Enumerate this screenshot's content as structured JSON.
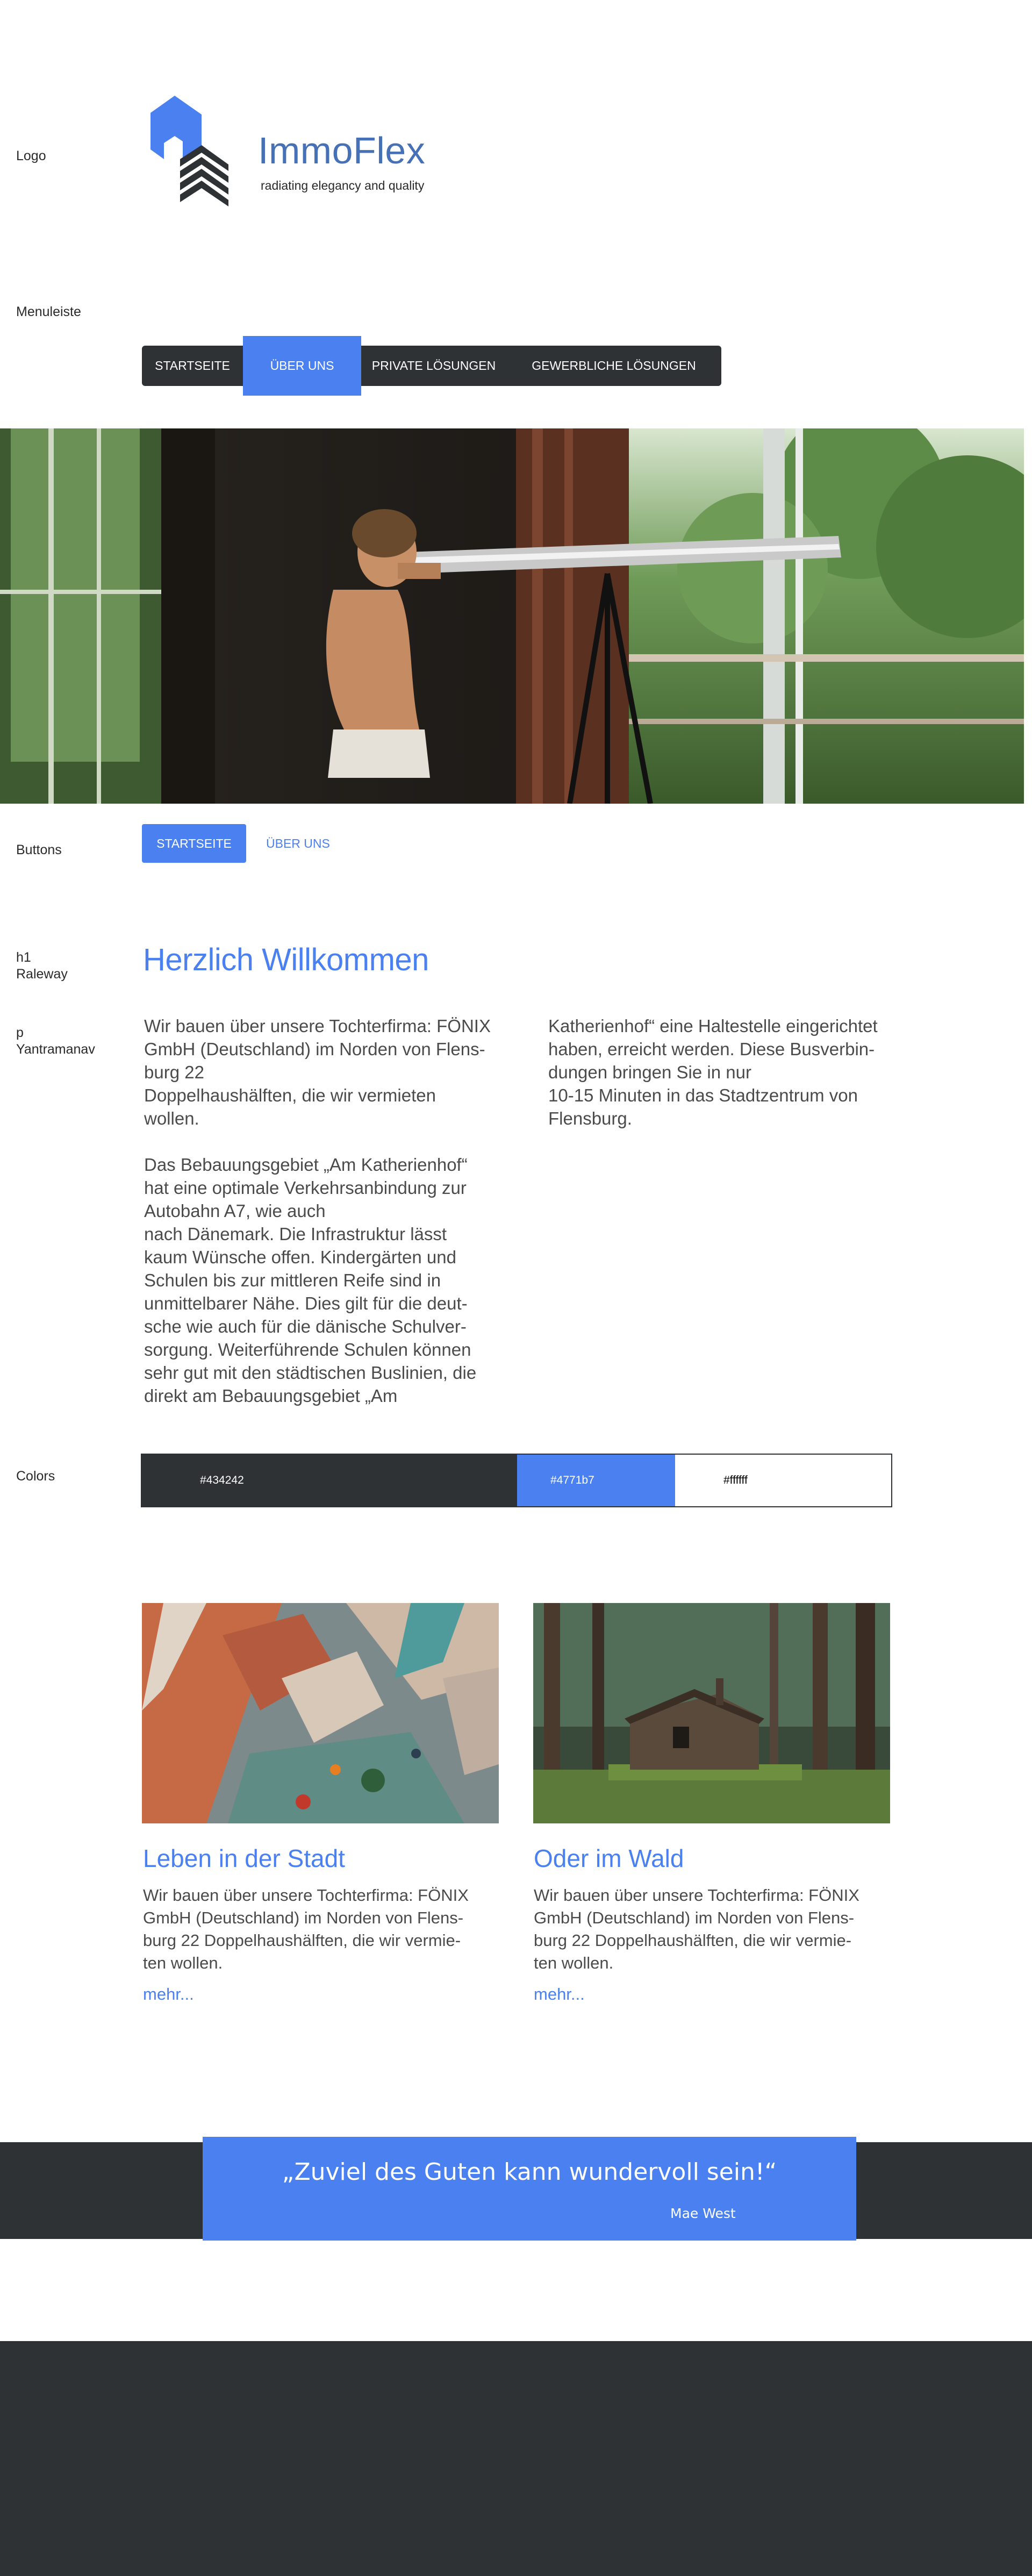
{
  "labels": {
    "logo": "Logo",
    "menu": "Menuleiste",
    "buttons": "Buttons",
    "h1_line1": "h1",
    "h1_line2": "Raleway",
    "p_line1": "p",
    "p_line2": "Yantramanav",
    "colors": "Colors"
  },
  "logo": {
    "name": "ImmoFlex",
    "tagline": "radiating elegancy and quality"
  },
  "menu": {
    "items": [
      {
        "label": "Startseite"
      },
      {
        "label": "Über uns"
      },
      {
        "label": "Private Lösungen"
      },
      {
        "label": "Gewerbliche Lösungen"
      }
    ],
    "active_index": 1
  },
  "buttons": {
    "primary": "Startseite",
    "secondary": "Über uns"
  },
  "headline": "Herzlich Willkommen",
  "paragraph": {
    "col1": "Wir bauen über unsere Tochterfirma: FÖNIX\nGmbH (Deutschland) im Norden von Flens-\nburg 22\nDoppelhaushälften, die wir vermieten\nwollen.\n\nDas Bebauungsgebiet „Am Katherienhof“\nhat eine optimale Verkehrsanbindung zur\nAutobahn A7, wie auch\nnach Dänemark. Die Infrastruktur lässt\nkaum Wünsche offen. Kindergärten und\nSchulen bis zur mittleren Reife sind in\nunmittelbarer Nähe. Dies gilt für die deut-\nsche wie auch für die dänische Schulver-\nsorgung. Weiterführende Schulen können\nsehr gut mit den städtischen Buslinien, die\ndirekt am Bebauungsgebiet „Am",
    "col2": "Katherienhof“ eine Haltestelle eingerichtet\nhaben, erreicht werden. Diese Busverbin-\ndungen bringen Sie in nur\n10-15 Minuten in das Stadtzentrum von\nFlensburg."
  },
  "colors": [
    {
      "hex": "#434242",
      "bg": "#2f3234",
      "fg": "#ffffff"
    },
    {
      "hex": "#4771b7",
      "bg": "#4a80f0",
      "fg": "#ffffff"
    },
    {
      "hex": "#ffffff",
      "bg": "#ffffff",
      "fg": "#000000"
    }
  ],
  "cards": [
    {
      "title": "Leben in der Stadt",
      "text": "Wir bauen über unsere Tochterfirma: FÖNIX\nGmbH (Deutschland) im Norden von Flens-\nburg 22 Doppelhaushälften, die wir vermie-\nten wollen.",
      "more": "mehr..."
    },
    {
      "title": "Oder im Wald",
      "text": "Wir bauen über unsere Tochterfirma: FÖNIX\nGmbH (Deutschland) im Norden von Flens-\nburg 22 Doppelhaushälften, die wir vermie-\nten wollen.",
      "more": "mehr..."
    }
  ],
  "quote": {
    "text": "„Zuviel des Guten kann wundervoll sein!“",
    "author": "Mae West"
  }
}
